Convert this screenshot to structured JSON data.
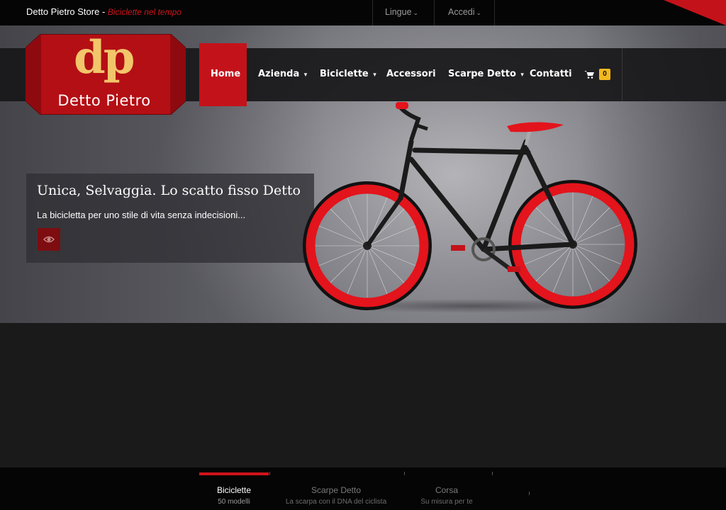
{
  "topbar": {
    "store_name": "Detto Pietro Store",
    "separator": " - ",
    "tagline": "Biciclette nel tempo",
    "language": "Lingue",
    "login": "Accedi"
  },
  "logo": {
    "mark": "dp",
    "name": "Detto Pietro"
  },
  "nav": {
    "items": [
      {
        "label": "Home",
        "active": true,
        "dropdown": false
      },
      {
        "label": "Azienda",
        "dropdown": true
      },
      {
        "label": "Biciclette",
        "dropdown": true
      },
      {
        "label": "Accessori",
        "dropdown": false
      },
      {
        "label": "Scarpe Detto",
        "dropdown": true
      },
      {
        "label": "Contatti",
        "dropdown": false
      }
    ],
    "cart_count": "0"
  },
  "hero": {
    "title": "Unica, Selvaggia. Lo scatto fisso Detto",
    "subtitle": "La bicicletta per uno stile di vita senza indecisioni..."
  },
  "slider_tabs": [
    {
      "title": "Biciclette",
      "subtitle": "50 modelli",
      "active": true
    },
    {
      "title": "Scarpe Detto",
      "subtitle": "La scarpa con il DNA del ciclista",
      "active": false
    },
    {
      "title": "Corsa",
      "subtitle": "Su misura per te",
      "active": false
    }
  ],
  "colors": {
    "accent": "#c4121a",
    "badge": "#f3b81f",
    "bike_rim": "#e3141c"
  }
}
